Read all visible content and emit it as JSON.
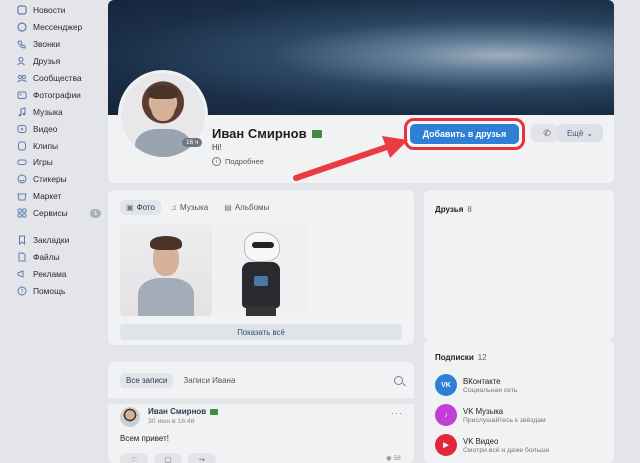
{
  "sidebar": {
    "items": [
      {
        "label": "Новости",
        "icon": "news-icon"
      },
      {
        "label": "Мессенджер",
        "icon": "chat-icon"
      },
      {
        "label": "Звонки",
        "icon": "phone-icon"
      },
      {
        "label": "Друзья",
        "icon": "friends-icon"
      },
      {
        "label": "Сообщества",
        "icon": "communities-icon"
      },
      {
        "label": "Фотографии",
        "icon": "photo-icon"
      },
      {
        "label": "Музыка",
        "icon": "music-icon"
      },
      {
        "label": "Видео",
        "icon": "video-icon"
      },
      {
        "label": "Клипы",
        "icon": "clips-icon"
      },
      {
        "label": "Игры",
        "icon": "games-icon"
      },
      {
        "label": "Стикеры",
        "icon": "stickers-icon"
      },
      {
        "label": "Маркет",
        "icon": "market-icon"
      },
      {
        "label": "Сервисы",
        "icon": "services-icon",
        "badge": "1"
      }
    ],
    "secondary": [
      {
        "label": "Закладки",
        "icon": "bookmark-icon"
      },
      {
        "label": "Файлы",
        "icon": "files-icon"
      },
      {
        "label": "Реклама",
        "icon": "ads-icon"
      },
      {
        "label": "Помощь",
        "icon": "help-icon"
      }
    ]
  },
  "profile": {
    "name": "Иван Смирнов",
    "status": "Hi!",
    "details_label": "Подробнее",
    "age_tag": "16 ч",
    "add_friend_label": "Добавить в друзья",
    "more_label": "Ещё"
  },
  "photos": {
    "tabs": [
      "Фото",
      "Музыка",
      "Альбомы"
    ],
    "show_all_label": "Показать всё"
  },
  "friends": {
    "title": "Друзья",
    "count": "8"
  },
  "subscriptions": {
    "title": "Подписки",
    "count": "12",
    "items": [
      {
        "name": "ВКонтакте",
        "desc": "Социальная сеть",
        "color": "#2f7fd6",
        "abbr": "VK"
      },
      {
        "name": "VK Музыка",
        "desc": "Прислушайтесь к звёздам",
        "color": "#c13fd6",
        "abbr": "♪"
      },
      {
        "name": "VK Видео",
        "desc": "Смотри всё и даже больше",
        "color": "#e4263b",
        "abbr": "▶"
      }
    ]
  },
  "wall": {
    "tabs": [
      "Все записи",
      "Записи Ивана"
    ],
    "post": {
      "author": "Иван Смирнов",
      "date": "30 июн в 16:48",
      "text": "Всем привет!",
      "views": "58"
    }
  },
  "colors": {
    "accent": "#2f7fd6",
    "highlight": "#e8323a",
    "background": "#e4e5e8"
  }
}
